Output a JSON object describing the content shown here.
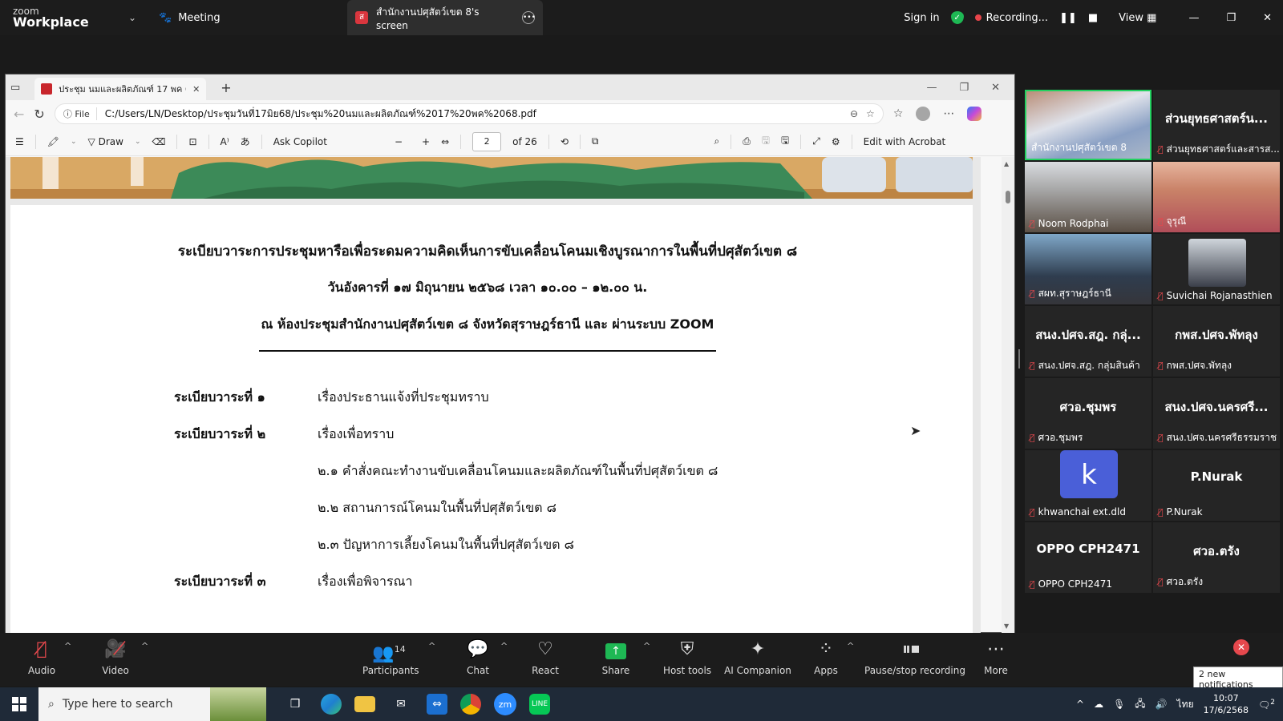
{
  "zoom_top": {
    "logo_line1": "zoom",
    "logo_line2": "Workplace",
    "meeting_label": "Meeting",
    "share_tab_label": "สำนักงานปศุสัตว์เขต 8's screen",
    "share_tab_badge": "ส",
    "sign_in": "Sign in",
    "recording_label": "Recording...",
    "view_label": "View"
  },
  "browser": {
    "tab_title": "ประชุม นมและผลิตภัณฑ์ 17 พค 68.pd",
    "file_label": "File",
    "url": "C:/Users/LN/Desktop/ประชุมวันที่17มิย68/ประชุม%20นมและผลิตภัณฑ์%2017%20พค%2068.pdf"
  },
  "pdf_toolbar": {
    "draw_label": "Draw",
    "ask_copilot": "Ask Copilot",
    "page_current": "2",
    "page_total": "of 26",
    "edit_acrobat": "Edit with Acrobat"
  },
  "document": {
    "title": "ระเบียบวาระการประชุมหารือเพื่อระดมความคิดเห็นการขับเคลื่อนโคนมเชิงบูรณาการในพื้นที่ปศุสัตว์เขต ๘",
    "date_line": "วันอังคารที่ ๑๗ มิถุนายน ๒๕๖๘ เวลา ๑๐.๐๐ – ๑๒.๐๐ น.",
    "venue_line": "ณ ห้องประชุมสำนักงานปศุสัตว์เขต ๘ จังหวัดสุราษฎร์ธานี และ ผ่านระบบ ZOOM",
    "agenda": [
      {
        "head": "ระเบียบวาระที่ ๑",
        "text": "เรื่องประธานแจ้งที่ประชุมทราบ"
      },
      {
        "head": "ระเบียบวาระที่ ๒",
        "text": "เรื่องเพื่อทราบ"
      },
      {
        "head": "",
        "text": "๒.๑ คำสั่งคณะทำงานขับเคลื่อนโคนมและผลิตภัณฑ์ในพื้นที่ปศุสัตว์เขต ๘"
      },
      {
        "head": "",
        "text": "๒.๒ สถานการณ์โคนมในพื้นที่ปศุสัตว์เขต ๘"
      },
      {
        "head": "",
        "text": "๒.๓ ปัญหาการเลี้ยงโคนมในพื้นที่ปศุสัตว์เขต ๘"
      },
      {
        "head": "ระเบียบวาระที่ ๓",
        "text": "เรื่องเพื่อพิจารณา"
      }
    ]
  },
  "gallery": {
    "tiles": [
      {
        "name": "สำนักงานปศุสัตว์เขต 8",
        "big": ""
      },
      {
        "name": "ส่วนยุทธศาสตร์และสารส...",
        "big": "ส่วนยุทธศาสตร์น..."
      },
      {
        "name": "Noom Rodphai",
        "big": ""
      },
      {
        "name": "จุรุณี",
        "big": ""
      },
      {
        "name": "สผท.สุราษฎร์ธานี",
        "big": ""
      },
      {
        "name": "Suvichai Rojanasthien",
        "big": ""
      },
      {
        "name": "สนง.ปศจ.สฎ. กลุ่มสินค้า",
        "big": "สนง.ปศจ.สฎ. กลุ่..."
      },
      {
        "name": "กพส.ปศจ.พัทลุง",
        "big": "กพส.ปศจ.พัทลุง"
      },
      {
        "name": "ศวอ.ชุมพร",
        "big": "ศวอ.ชุมพร"
      },
      {
        "name": "สนง.ปศจ.นครศรีธรรมราช",
        "big": "สนง.ปศจ.นครศรี..."
      },
      {
        "name": "khwanchai ext.dld",
        "big": "",
        "avatar": "k"
      },
      {
        "name": "P.Nurak",
        "big": "P.Nurak"
      },
      {
        "name": "OPPO CPH2471",
        "big": "OPPO CPH2471"
      },
      {
        "name": "ศวอ.ตรัง",
        "big": "ศวอ.ตรัง"
      }
    ]
  },
  "controls": {
    "audio": "Audio",
    "video": "Video",
    "participants": "Participants",
    "participants_count": "14",
    "chat": "Chat",
    "react": "React",
    "share": "Share",
    "host_tools": "Host tools",
    "ai_companion": "AI Companion",
    "apps": "Apps",
    "pause_stop": "Pause/stop recording",
    "more": "More",
    "notification": "2 new notifications"
  },
  "taskbar": {
    "search_placeholder": "Type here to search",
    "language": "ไทย",
    "time": "10:07",
    "date": "17/6/2568",
    "notif_count": "2"
  },
  "colors": {
    "zoom_bg": "#1c1c1c",
    "accent_green": "#1eb854",
    "mute_red": "#e5484d",
    "avatar_blue": "#4a5fd8"
  }
}
